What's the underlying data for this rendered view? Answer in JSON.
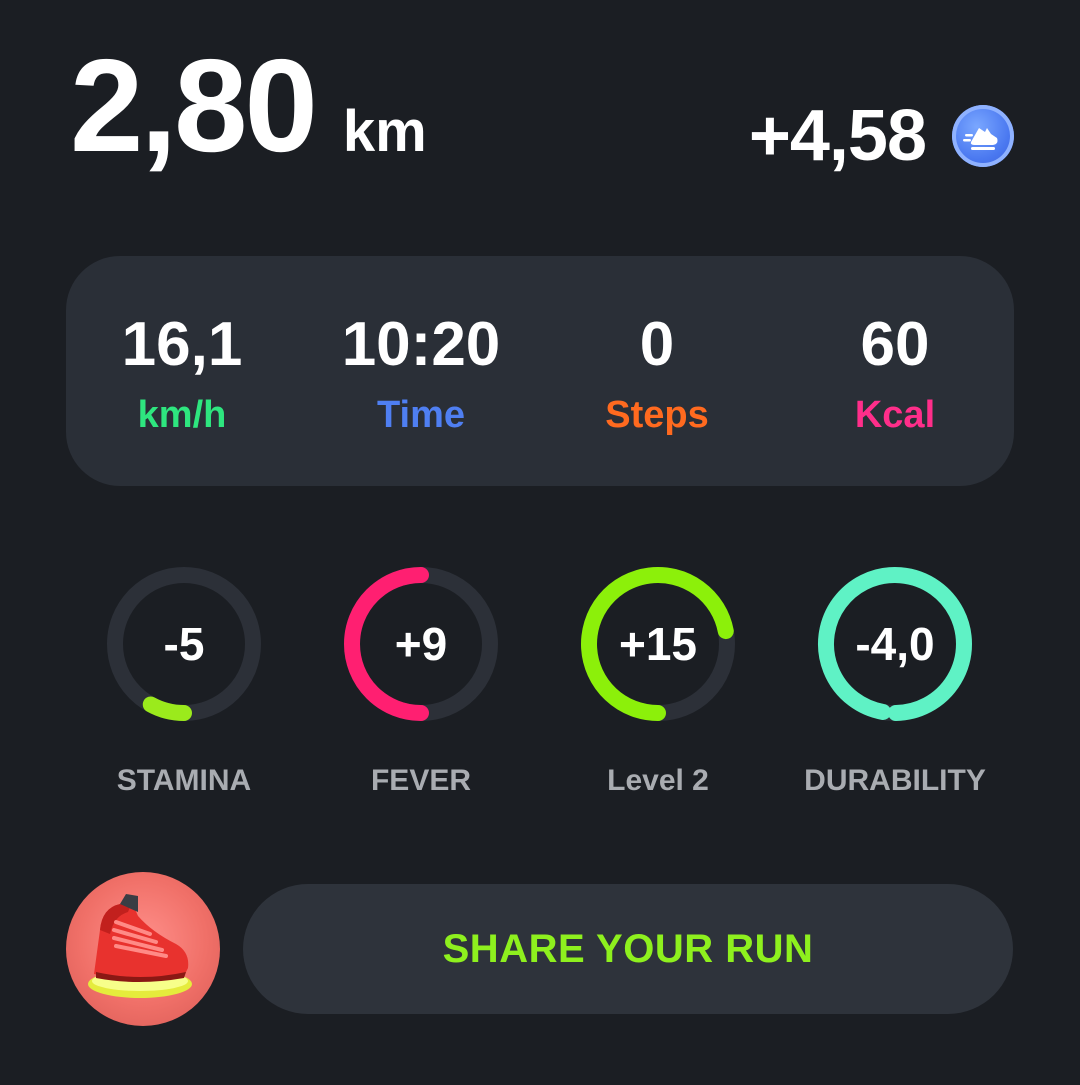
{
  "distance": {
    "value": "2,80",
    "unit": "km"
  },
  "earnings": {
    "value": "+4,58",
    "icon": "running-shoe-token-icon"
  },
  "stats": [
    {
      "value": "16,1",
      "label": "km/h",
      "color": "#2ee67f"
    },
    {
      "value": "10:20",
      "label": "Time",
      "color": "#4f7ff2"
    },
    {
      "value": "0",
      "label": "Steps",
      "color": "#ff6a1f"
    },
    {
      "value": "60",
      "label": "Kcal",
      "color": "#ff2e8a"
    }
  ],
  "rings": [
    {
      "value": "-5",
      "label": "STAMINA",
      "progress": 0.08,
      "start_deg": 180,
      "color": "#9bea1c"
    },
    {
      "value": "+9",
      "label": "FEVER",
      "progress": 0.5,
      "start_deg": 180,
      "color": "#ff1f71"
    },
    {
      "value": "+15",
      "label": "Level 2",
      "progress": 0.72,
      "start_deg": 180,
      "color": "#8cf00a"
    },
    {
      "value": "-4,0",
      "label": "DURABILITY",
      "progress": 0.97,
      "start_deg": 190,
      "color": "#5ff2c5"
    }
  ],
  "ring_track_color": "#2c3038",
  "share": {
    "label": "SHARE YOUR RUN"
  },
  "avatar": {
    "icon": "red-sneaker-icon"
  }
}
